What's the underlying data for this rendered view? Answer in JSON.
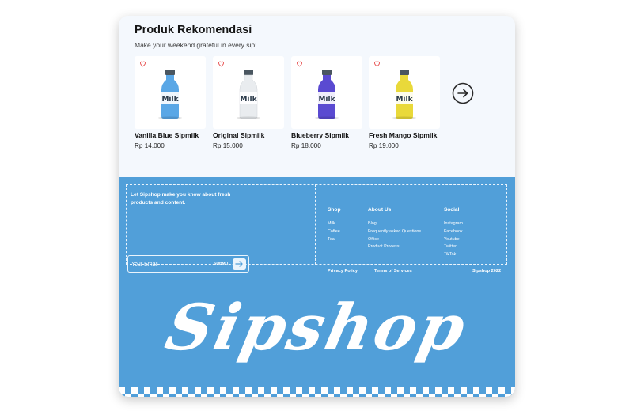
{
  "colors": {
    "brand_blue": "#519fd9",
    "panel_background": "#f4f8fd",
    "heart_red": "#e74c4c"
  },
  "recommendations": {
    "title": "Produk Rekomendasi",
    "subtitle": "Make your weekend grateful in every sip!",
    "next_icon": "arrow-right-circle-icon",
    "products": [
      {
        "name": "Vanilla Blue Sipmilk",
        "price": "Rp 14.000",
        "bottle_color": "#5aa7e6",
        "favorite_icon": "heart-icon"
      },
      {
        "name": "Original Sipmilk",
        "price": "Rp 15.000",
        "bottle_color": "#e9ecef",
        "favorite_icon": "heart-icon"
      },
      {
        "name": "Blueberry Sipmilk",
        "price": "Rp 18.000",
        "bottle_color": "#5a4ad1",
        "favorite_icon": "heart-icon"
      },
      {
        "name": "Fresh Mango Sipmilk",
        "price": "Rp 19.000",
        "bottle_color": "#e9d93a",
        "favorite_icon": "heart-icon"
      }
    ]
  },
  "footer": {
    "newsletter_text": "Let Sipshop make you know about fresh products and content.",
    "email_placeholder": "Your Email",
    "submit_label": "SUBMIT",
    "columns": [
      {
        "heading": "Shop",
        "links": [
          "Milk",
          "Coffee",
          "Tea"
        ]
      },
      {
        "heading": "About Us",
        "links": [
          "Blog",
          "Frequently asked Questions",
          "Office",
          "Product Process"
        ]
      },
      {
        "heading": "Social",
        "links": [
          "Instagram",
          "Facebook",
          "Youtube",
          "Twitter",
          "TikTok"
        ]
      }
    ],
    "privacy": "Privacy Policy",
    "terms": "Terms of Services",
    "copyright": "Sipshop 2022",
    "brand": "Sipshop"
  }
}
